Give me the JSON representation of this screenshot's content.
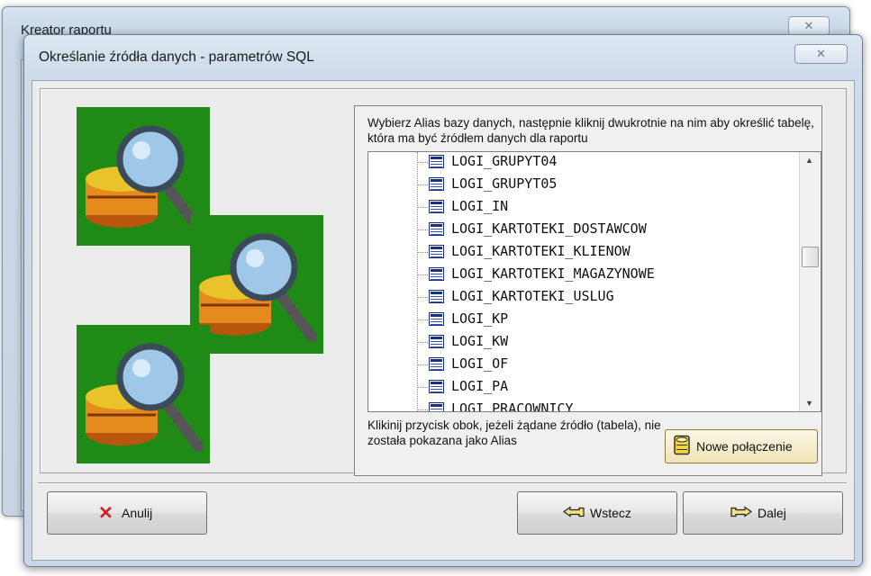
{
  "outer_window": {
    "title": "Kreator raportu",
    "close_glyph": "✕"
  },
  "dialog": {
    "title": "Określanie źródła danych - parametrów SQL",
    "close_glyph": "✕"
  },
  "instruction": "Wybierz Alias bazy danych, następnie kliknij dwukrotnie na nim aby określić tabelę,  która ma być źródłem danych dla raportu",
  "tables": [
    "LOGI_GRUPYT04",
    "LOGI_GRUPYT05",
    "LOGI_IN",
    "LOGI_KARTOTEKI_DOSTAWCOW",
    "LOGI_KARTOTEKI_KLIENOW",
    "LOGI_KARTOTEKI_MAGAZYNOWE",
    "LOGI_KARTOTEKI_USLUG",
    "LOGI_KP",
    "LOGI_KW",
    "LOGI_OF",
    "LOGI_PA",
    "LOGI_PRACOWNICY"
  ],
  "scrollbar": {
    "up_glyph": "▲",
    "down_glyph": "▼"
  },
  "hint": "Klikinij przycisk obok, jeżeli żądane źródło (tabela), nie została pokazana jako Alias",
  "buttons": {
    "new_connection": "Nowe połączenie",
    "cancel": "Anulij",
    "back": "Wstecz",
    "next": "Dalej"
  },
  "icons": {
    "image": "database-search-icon",
    "table": "table-icon",
    "new_connection": "database-connection-icon",
    "cancel": "red-x-icon",
    "back": "hand-pointing-left-icon",
    "next": "hand-pointing-right-icon"
  },
  "colors": {
    "picture_bg": "#1f8a16",
    "cancel_x": "#d42020",
    "list_bg": "#ffffff",
    "dialog_bg": "#ececec"
  }
}
